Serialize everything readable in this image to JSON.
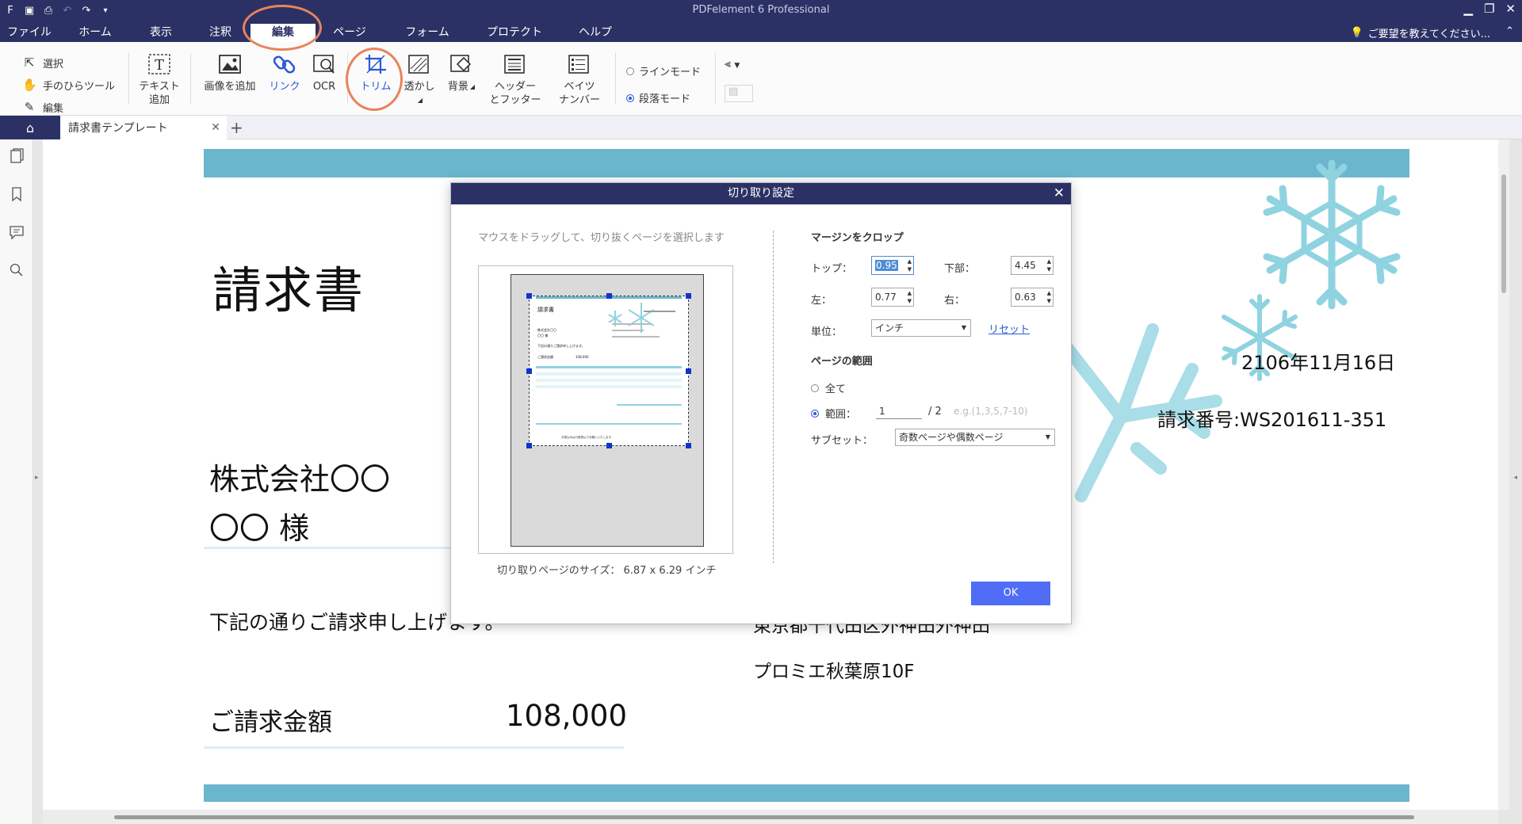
{
  "app": {
    "title": "PDFelement 6 Professional"
  },
  "menu": {
    "items": [
      "ファイル",
      "ホーム",
      "表示",
      "注釈",
      "編集",
      "ページ",
      "フォーム",
      "プロテクト",
      "ヘルプ"
    ],
    "active": "編集",
    "help_hint": "ご要望を教えてください..."
  },
  "ribbon": {
    "tool_list": [
      "選択",
      "手のひらツール",
      "編集"
    ],
    "buttons": {
      "add_text": "テキスト\n追加",
      "add_image": "画像を追加",
      "link": "リンク",
      "ocr": "OCR",
      "trim": "トリム",
      "watermark": "透かし",
      "background": "背景",
      "header_footer": "ヘッダー\nとフッター",
      "bates": "ベイツ\nナンバー"
    },
    "modes": {
      "line": "ラインモード",
      "paragraph": "段落モード"
    }
  },
  "tabs": {
    "doc_title": "請求書テンプレート"
  },
  "document": {
    "title": "請求書",
    "date": "2106年11月16日",
    "invoice_no": "請求番号:WS201611-351",
    "company": "株式会社〇〇",
    "recipient": "〇〇 様",
    "body": "下記の通りご請求申し上げます。",
    "amount_label": "ご請求金額",
    "amount_value": "108,000",
    "address_cut": "東京都千代田区外神田外神田",
    "building": "プロミエ秋葉原10F"
  },
  "dialog": {
    "title": "切り取り設定",
    "hint": "マウスをドラッグして、切り抜くページを選択します",
    "crop_size": "切り取りページのサイズ： 6.87 x 6.29 インチ",
    "section_margin": "マージンをクロップ",
    "top_label": "トップ：",
    "top_value": "0.95",
    "bottom_label": "下部：",
    "bottom_value": "4.45",
    "left_label": "左：",
    "left_value": "0.77",
    "right_label": "右：",
    "right_value": "0.63",
    "unit_label": "単位：",
    "unit_value": "インチ",
    "reset": "リセット",
    "section_range": "ページの範囲",
    "all": "全て",
    "range_label": "範囲：",
    "range_value": "1",
    "range_total": "/  2",
    "range_placeholder": "e.g.(1,3,5,7-10)",
    "subset_label": "サブセット：",
    "subset_value": "奇数ページや偶数ページ",
    "ok": "OK",
    "thumb": {
      "title": "請求書",
      "company": "株式会社〇〇",
      "recipient": "〇〇 様",
      "body": "下記の通りご請求申し上げます。",
      "amount_label": "ご請求金額",
      "amount_value": "108,000",
      "footer": "お振込みは口座振込でお願いいたします。"
    }
  },
  "colors": {
    "brand": "#2b3164",
    "accent": "#2b57d9",
    "band": "#6ab7cd",
    "annotation": "#e9835b",
    "snow": "#8fd3e0"
  }
}
